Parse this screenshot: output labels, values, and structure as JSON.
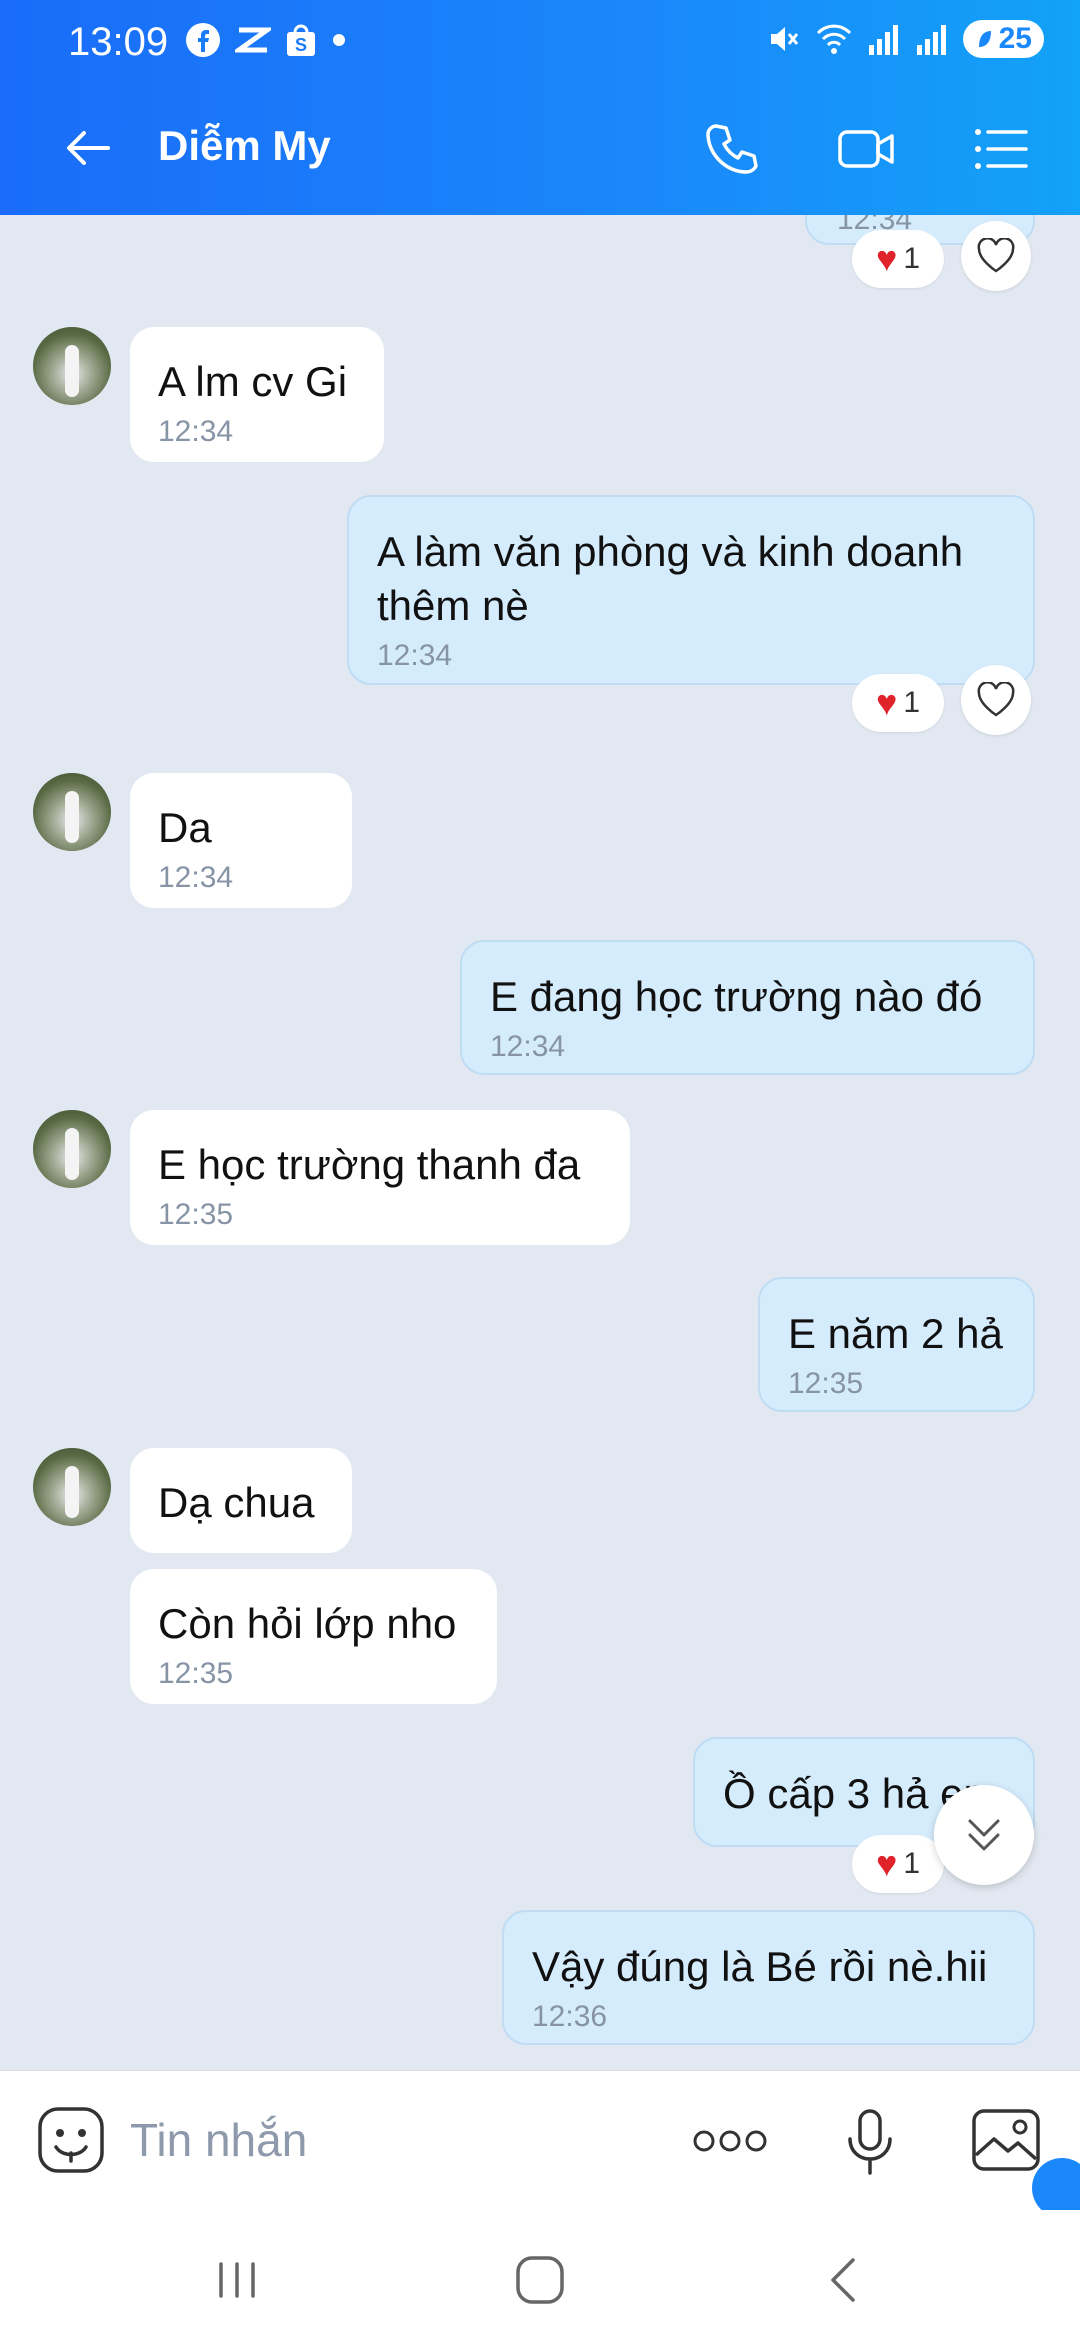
{
  "status_bar": {
    "time": "13:09",
    "battery": "25"
  },
  "header": {
    "title": "Diễm My"
  },
  "messages": [
    {
      "side": "in",
      "text": "A lm cv Gi",
      "time": "12:34"
    },
    {
      "side": "out",
      "text": "A làm văn phòng và kinh doanh thêm nè",
      "time": "12:34",
      "reaction_count": "1"
    },
    {
      "side": "in",
      "text": "Da",
      "time": "12:34"
    },
    {
      "side": "out",
      "text": "E đang học trường nào đó",
      "time": "12:34"
    },
    {
      "side": "in",
      "text": "E học trường thanh đa",
      "time": "12:35"
    },
    {
      "side": "out",
      "text": "E năm 2 hả",
      "time": "12:35"
    },
    {
      "side": "in",
      "text": "Dạ chua",
      "time": ""
    },
    {
      "side": "in",
      "text": "Còn hỏi lớp nho",
      "time": "12:35"
    },
    {
      "side": "out",
      "text": "Ồ cấp 3 hả em",
      "time": "",
      "reaction_count": "1"
    },
    {
      "side": "out",
      "text": "Vậy đúng là Bé rồi nè.hii",
      "time": "12:36"
    }
  ],
  "top_partial": {
    "time": "12:34",
    "reaction_count": "1"
  },
  "input": {
    "placeholder": "Tin nhắn"
  },
  "colors": {
    "header_start": "#1a6cf8",
    "header_end": "#12a2f7",
    "outgoing_bubble": "#d5ecfd",
    "incoming_bubble": "#ffffff",
    "heart": "#e0222b"
  }
}
